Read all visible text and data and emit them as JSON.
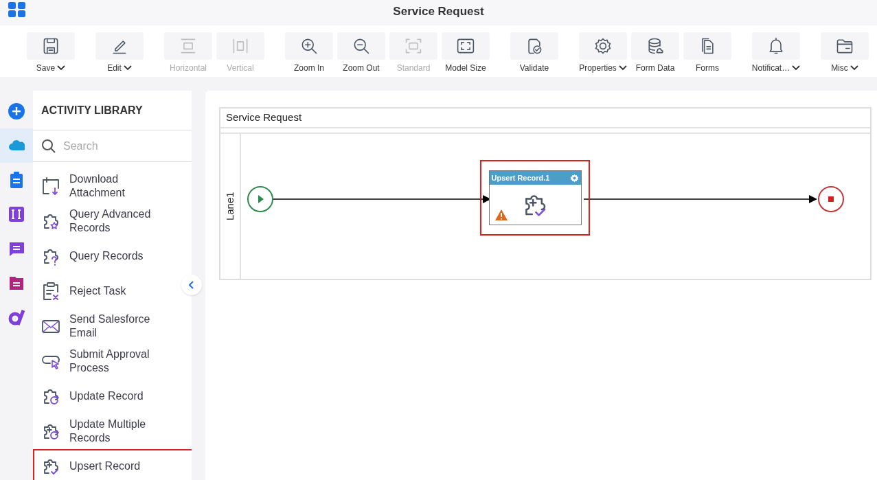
{
  "app": {
    "title": "Service Request"
  },
  "toolbar": [
    [
      {
        "label": "Save",
        "kind": "save",
        "disabled": false,
        "dropdown": true
      }
    ],
    [
      {
        "label": "Edit",
        "kind": "edit",
        "disabled": false,
        "dropdown": true
      }
    ],
    [
      {
        "label": "Horizontal",
        "kind": "horizontal",
        "disabled": true,
        "dropdown": false
      },
      {
        "label": "Vertical",
        "kind": "vertical",
        "disabled": true,
        "dropdown": false
      }
    ],
    [
      {
        "label": "Zoom In",
        "kind": "zoomin",
        "disabled": false,
        "dropdown": false
      },
      {
        "label": "Zoom Out",
        "kind": "zoomout",
        "disabled": false,
        "dropdown": false
      },
      {
        "label": "Standard",
        "kind": "standard",
        "disabled": true,
        "dropdown": false
      },
      {
        "label": "Model Size",
        "kind": "modelsize",
        "disabled": false,
        "dropdown": false
      }
    ],
    [
      {
        "label": "Validate",
        "kind": "validate",
        "disabled": false,
        "dropdown": false
      }
    ],
    [
      {
        "label": "Properties",
        "kind": "gear",
        "disabled": false,
        "dropdown": true
      },
      {
        "label": "Form Data",
        "kind": "database",
        "disabled": false,
        "dropdown": false
      },
      {
        "label": "Forms",
        "kind": "forms",
        "disabled": false,
        "dropdown": false
      }
    ],
    [
      {
        "label": "Notificat…",
        "kind": "bell",
        "disabled": false,
        "dropdown": true
      }
    ],
    [
      {
        "label": "Misc",
        "kind": "folder",
        "disabled": false,
        "dropdown": true
      }
    ]
  ],
  "rail": [
    {
      "kind": "plus",
      "selected": false
    },
    {
      "kind": "cloud",
      "selected": true
    },
    {
      "kind": "clipboard",
      "selected": false
    },
    {
      "kind": "bars",
      "selected": false
    },
    {
      "kind": "chat",
      "selected": false
    },
    {
      "kind": "doc",
      "selected": false
    },
    {
      "kind": "logo",
      "selected": false
    }
  ],
  "library": {
    "title": "ACTIVITY LIBRARY",
    "search": {
      "placeholder": "Search"
    },
    "items": [
      {
        "label": "Download Attachment",
        "kind": "download",
        "selected": false
      },
      {
        "label": "Query Advanced Records",
        "kind": "star",
        "selected": false
      },
      {
        "label": "Query Records",
        "kind": "question",
        "selected": false
      },
      {
        "label": "Reject Task",
        "kind": "reject",
        "selected": false
      },
      {
        "label": "Send Salesforce Email",
        "kind": "mail",
        "selected": false
      },
      {
        "label": "Submit Approval Process",
        "kind": "pointer",
        "selected": false
      },
      {
        "label": "Update Record",
        "kind": "refresh",
        "selected": false
      },
      {
        "label": "Update Multiple Records",
        "kind": "refreshplus",
        "selected": false
      },
      {
        "label": "Upsert Record",
        "kind": "checkplus",
        "selected": true
      }
    ]
  },
  "diagram": {
    "pool": "Service Request",
    "lane": "Lane1",
    "task": {
      "title": "Upsert Record.1",
      "warning": true,
      "selected": true
    }
  }
}
